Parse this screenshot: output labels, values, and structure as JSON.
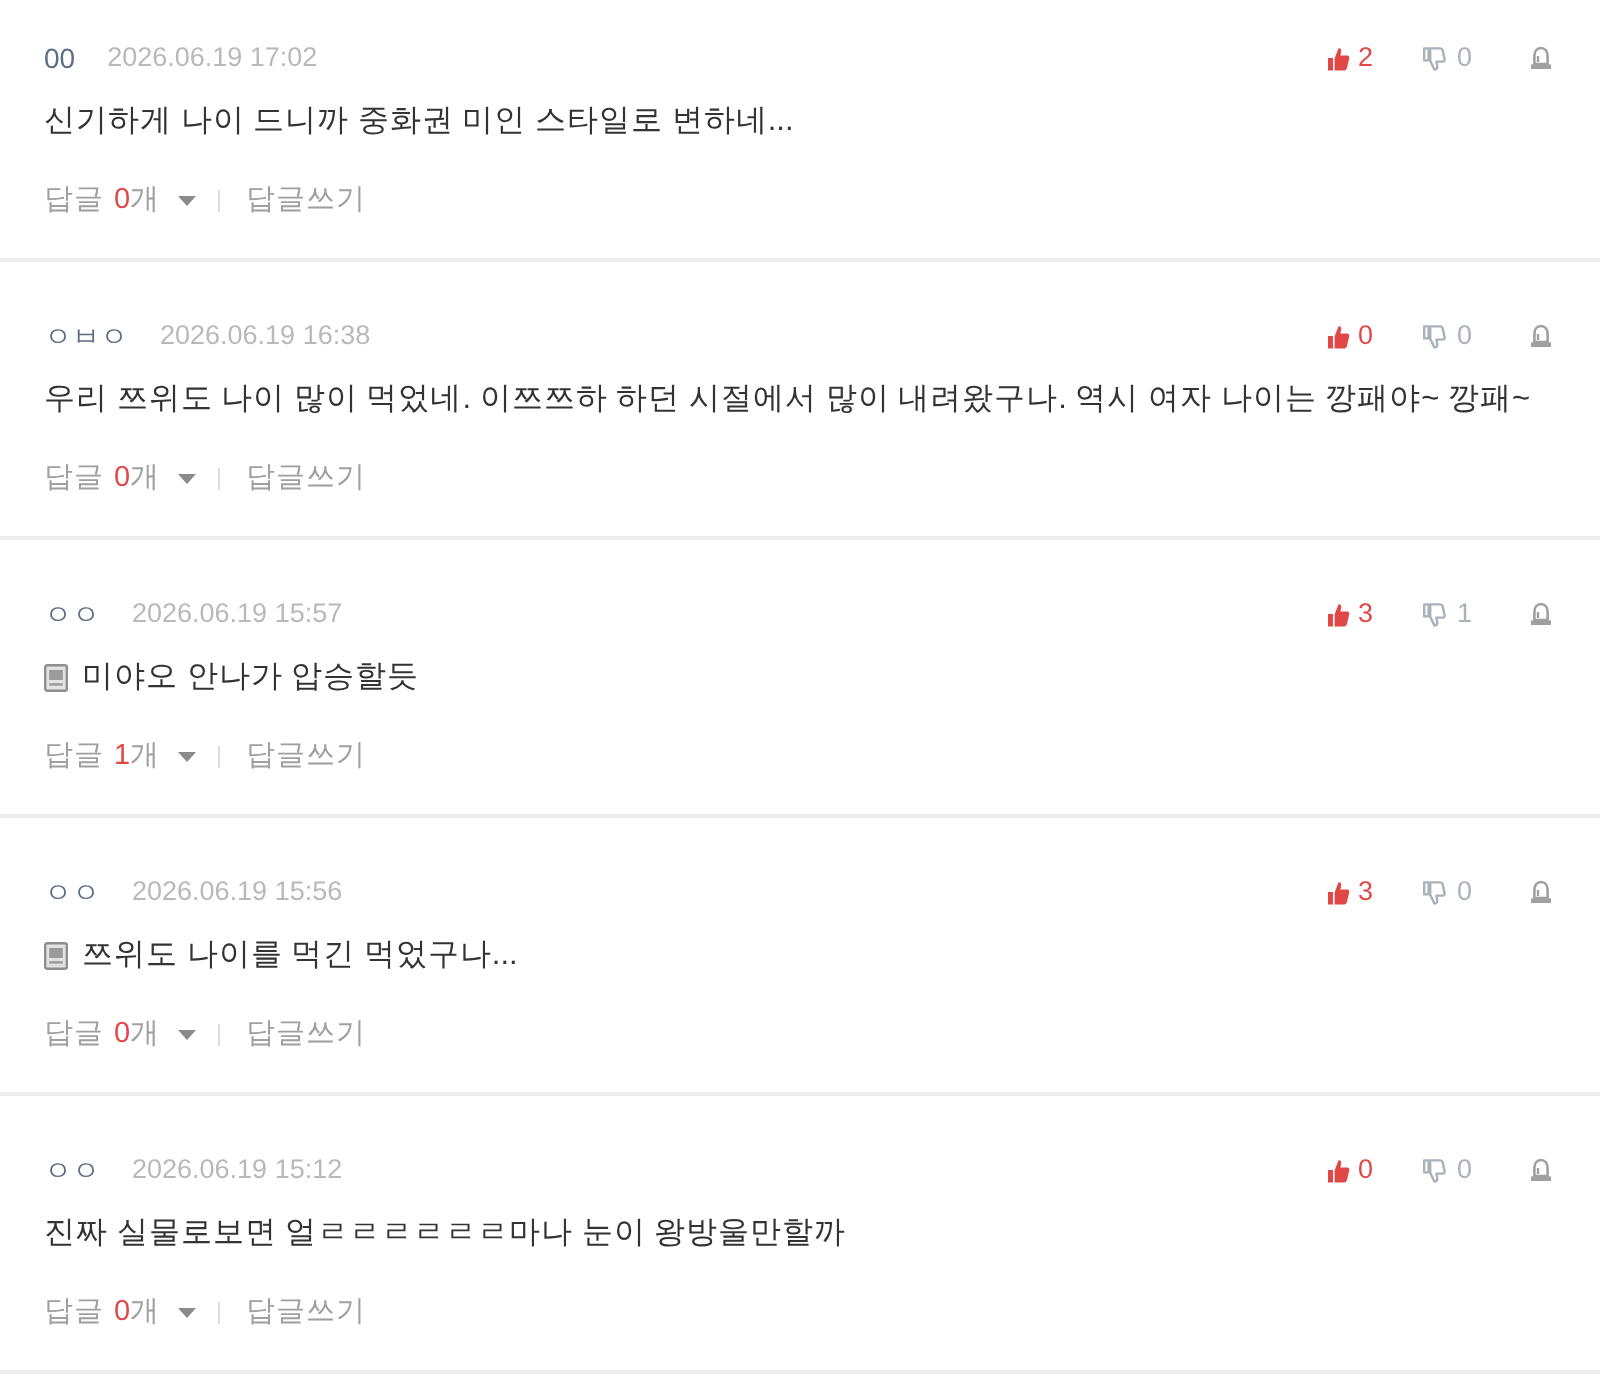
{
  "comments": [
    {
      "author": "00",
      "date": "2026.06.19 17:02",
      "memo_icon": false,
      "text": "신기하게 나이 드니까 중화권 미인 스타일로 변하네...",
      "likes": "2",
      "dislikes": "0",
      "reply_label": "답글",
      "reply_count": "0",
      "reply_unit": "개",
      "write_reply": "답글쓰기"
    },
    {
      "author": "ㅇㅂㅇ",
      "date": "2026.06.19 16:38",
      "memo_icon": false,
      "text": "우리 쯔위도 나이 많이 먹었네. 이쯔쯔하 하던 시절에서 많이 내려왔구나. 역시 여자 나이는 깡패야~ 깡패~",
      "likes": "0",
      "dislikes": "0",
      "reply_label": "답글",
      "reply_count": "0",
      "reply_unit": "개",
      "write_reply": "답글쓰기"
    },
    {
      "author": "ㅇㅇ",
      "date": "2026.06.19 15:57",
      "memo_icon": true,
      "text": "미야오 안나가 압승할듯",
      "likes": "3",
      "dislikes": "1",
      "reply_label": "답글",
      "reply_count": "1",
      "reply_unit": "개",
      "write_reply": "답글쓰기"
    },
    {
      "author": "ㅇㅇ",
      "date": "2026.06.19 15:56",
      "memo_icon": true,
      "text": "쯔위도 나이를 먹긴 먹었구나...",
      "likes": "3",
      "dislikes": "0",
      "reply_label": "답글",
      "reply_count": "0",
      "reply_unit": "개",
      "write_reply": "답글쓰기"
    },
    {
      "author": "ㅇㅇ",
      "date": "2026.06.19 15:12",
      "memo_icon": false,
      "text": "진짜 실물로보면 얼ㄹㄹㄹㄹㄹㄹ마나 눈이 왕방울만할까",
      "likes": "0",
      "dislikes": "0",
      "reply_label": "답글",
      "reply_count": "0",
      "reply_unit": "개",
      "write_reply": "답글쓰기"
    }
  ]
}
